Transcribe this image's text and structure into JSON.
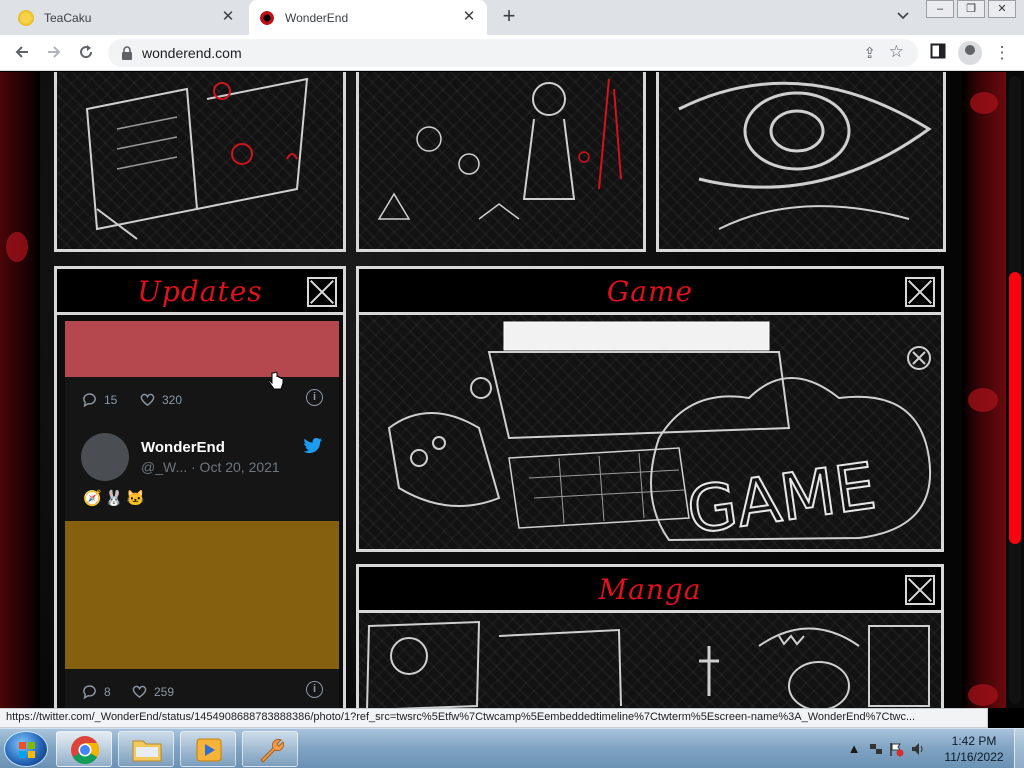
{
  "browser": {
    "tabs": [
      {
        "title": "TeaCaku",
        "active": false
      },
      {
        "title": "WonderEnd",
        "active": true
      }
    ],
    "url": "wonderend.com",
    "status_link": "https://twitter.com/_WonderEnd/status/1454908688783888386/photo/1?ref_src=twsrc%5Etfw%7Ctwcamp%5Eembeddedtimeline%7Ctwterm%5Escreen-name%3A_WonderEnd%7Ctwc..."
  },
  "page": {
    "updates_title": "Updates",
    "game_title": "Game",
    "manga_title": "Manga",
    "game_art_text": "GAME"
  },
  "feed": {
    "tweet1": {
      "replies": "15",
      "likes": "320",
      "media_color": "#b5474e"
    },
    "tweet2": {
      "name": "WonderEnd",
      "handle": "@_W...",
      "date": "· Oct 20, 2021",
      "emoji": "🧭🐰🐱",
      "replies": "8",
      "likes": "259",
      "media_color": "#85600f"
    }
  },
  "taskbar": {
    "time": "1:42 PM",
    "date": "11/16/2022"
  },
  "colors": {
    "accent_red": "#e0101c",
    "scroll_thumb": "#ff0010",
    "twitter_blue": "#1d9bf0"
  }
}
